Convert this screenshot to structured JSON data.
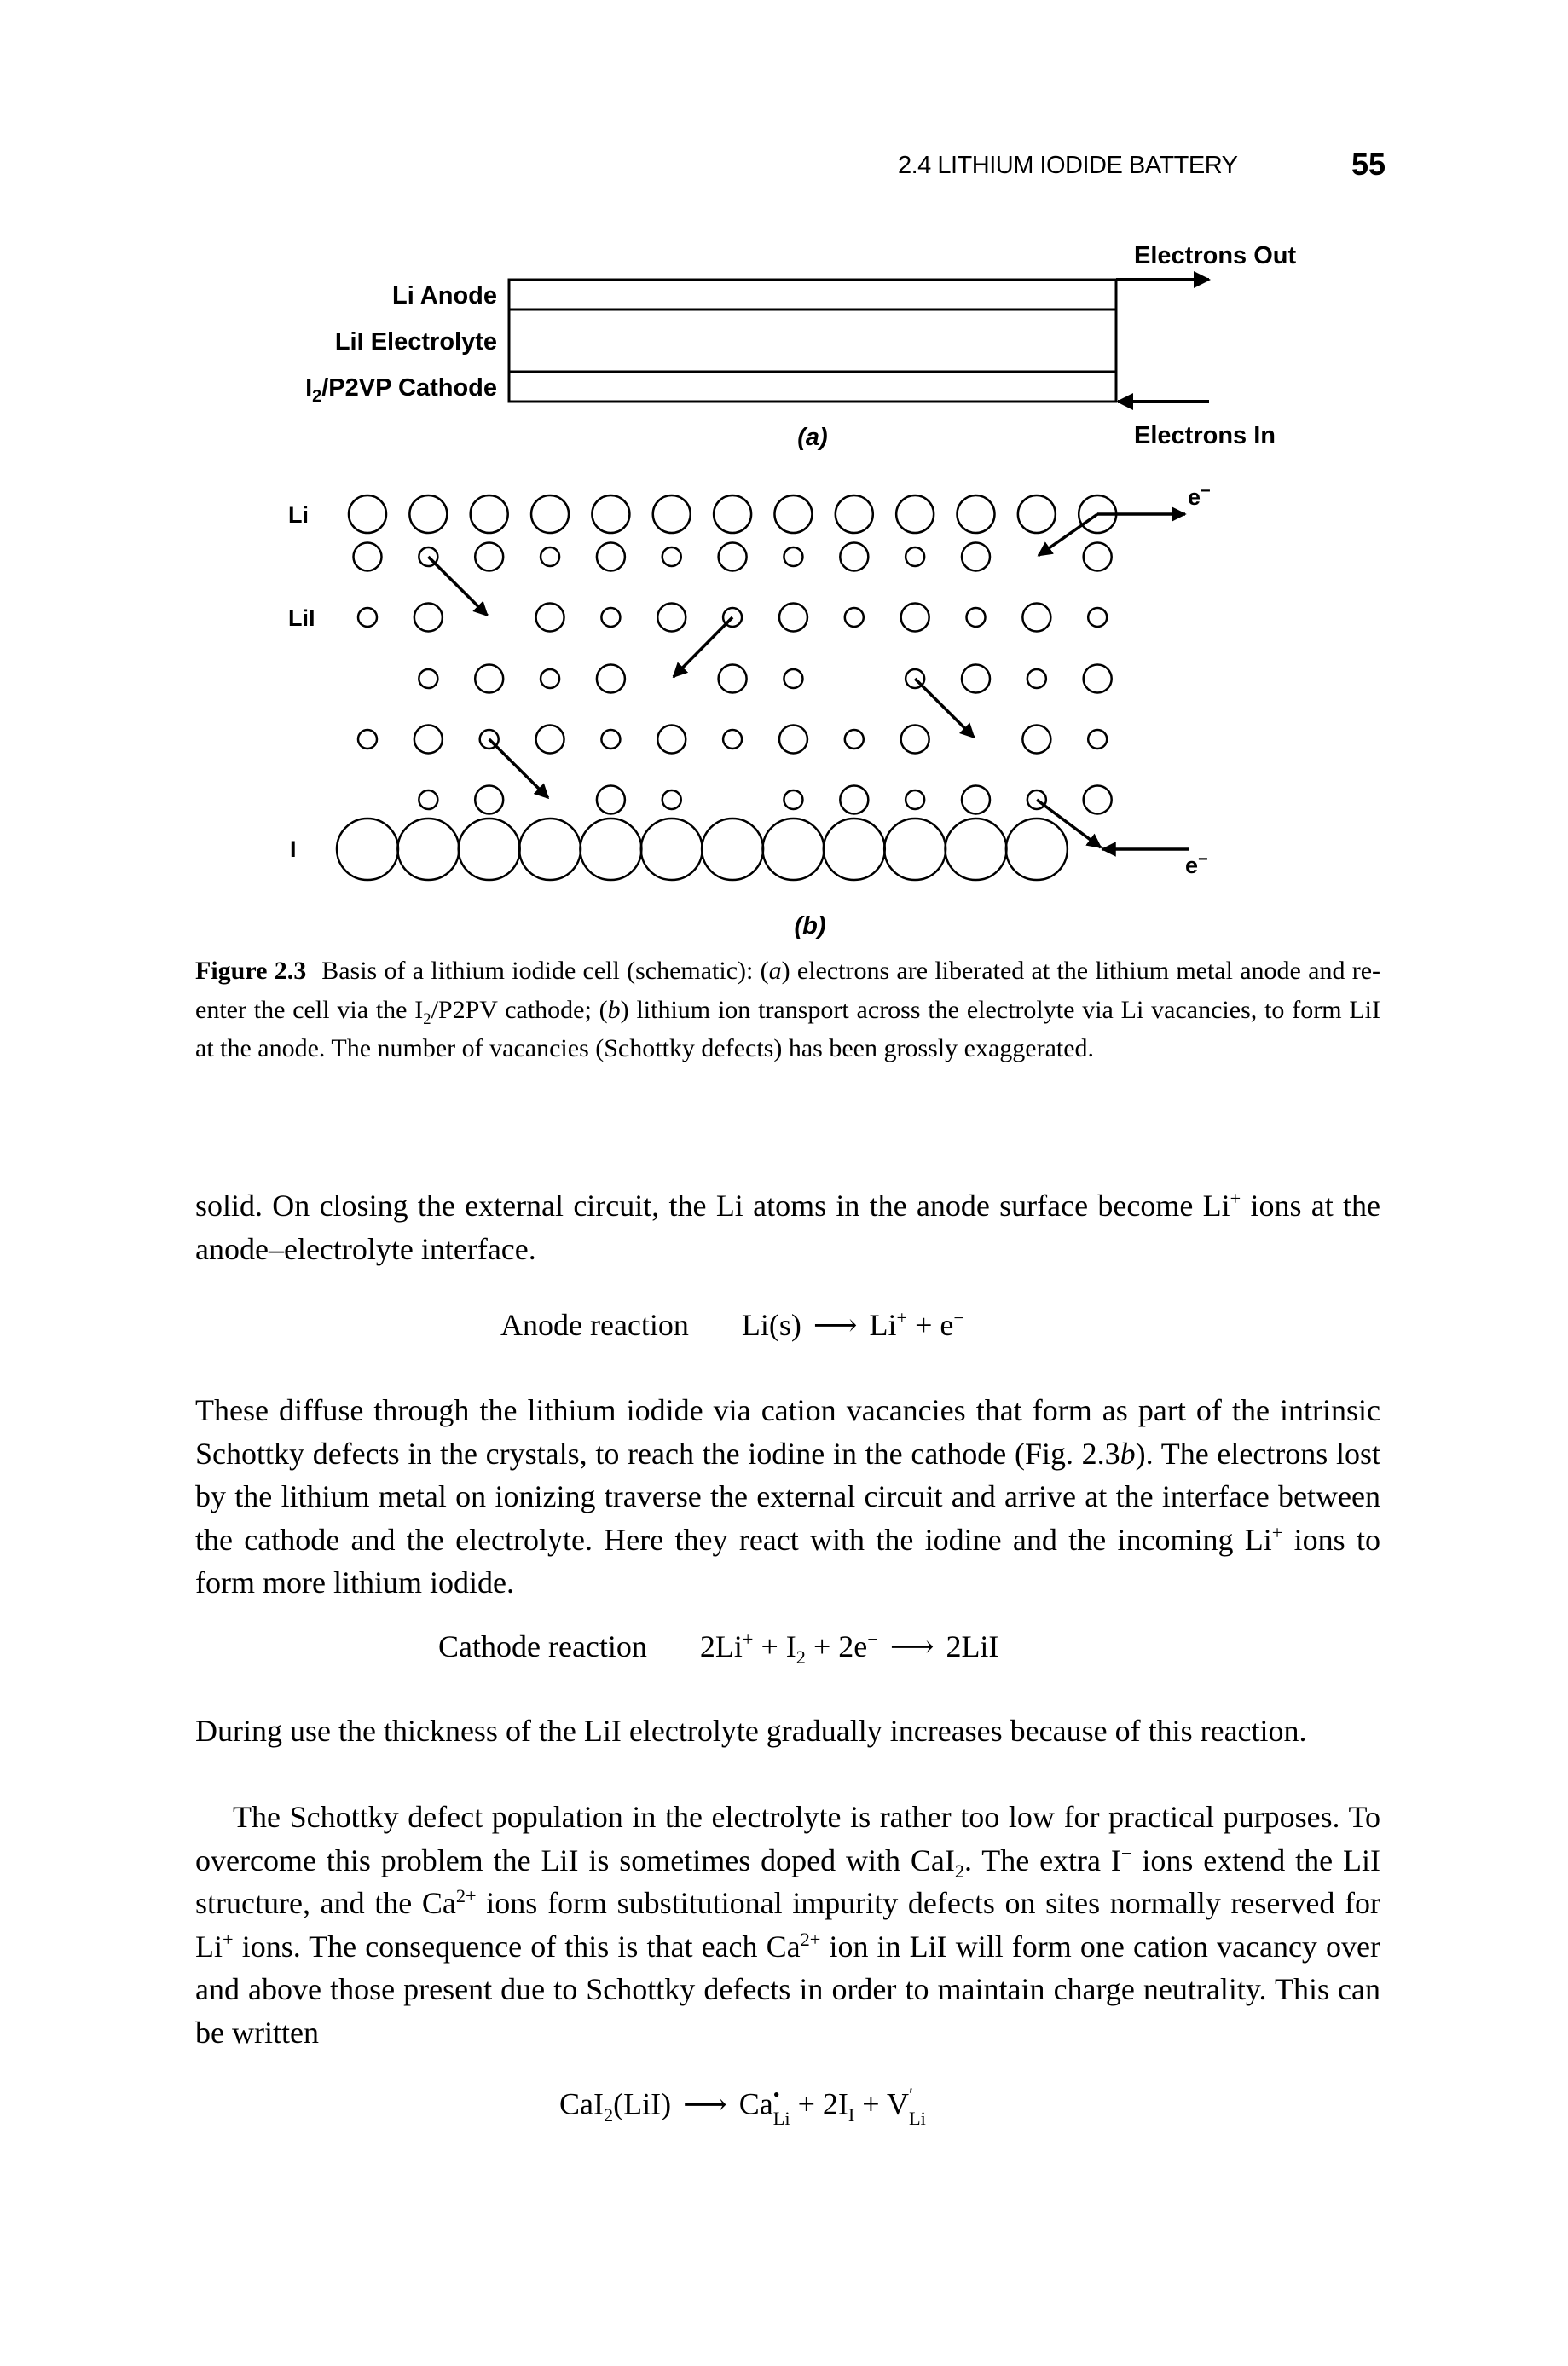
{
  "header": {
    "running_title": "2.4 LITHIUM IODIDE BATTERY",
    "page_number": "55"
  },
  "figure": {
    "panel_a": {
      "layer_labels": [
        "Li Anode",
        "LiI Electrolyte",
        "/P2VP  Cathode"
      ],
      "cathode_label_prefix": "I",
      "cathode_label_sub": "2",
      "electrons_out": "Electrons Out",
      "electrons_in": "Electrons In",
      "panel_label": "(a)"
    },
    "panel_b": {
      "row_labels": {
        "li": "Li",
        "lii": "LiI",
        "i": "I"
      },
      "electron_label": "e",
      "electron_sup": "−",
      "panel_label": "(b)",
      "rows": [
        {
          "name": "Li",
          "sites": "LLLLLLLLLLLLL",
          "kind": "li"
        },
        {
          "name": "row2",
          "sites": "BsBsBsBsBsB_B",
          "kind": "ion"
        },
        {
          "name": "LiI",
          "sites": "sB_BsBsBsBsBs",
          "kind": "ion"
        },
        {
          "name": "row4",
          "sites": "_sBsB_Bs_sBsB",
          "kind": "ion"
        },
        {
          "name": "row5",
          "sites": "sBsBsBsBsB_Bs",
          "kind": "ion"
        },
        {
          "name": "row6",
          "sites": "_sB_Bs_sBsBsB",
          "kind": "ion"
        },
        {
          "name": "I",
          "sites": "IIIIIIIIIIII",
          "kind": "iodine"
        }
      ],
      "vacancy_jumps": [
        {
          "from_row": 1,
          "from_col": 1,
          "to_row": 2,
          "to_col": 2
        },
        {
          "from_row": 2,
          "from_col": 6,
          "to_row": 3,
          "to_col": 5
        },
        {
          "from_row": 3,
          "from_col": 9,
          "to_row": 4,
          "to_col": 10
        },
        {
          "from_row": 4,
          "from_col": 2,
          "to_row": 5,
          "to_col": 3
        },
        {
          "from_row": 0,
          "from_col": 12,
          "to_row": 1,
          "to_col": 11
        }
      ]
    }
  },
  "caption": {
    "label": "Figure 2.3",
    "text_1": "Basis of a lithium iodide cell (schematic): (",
    "a": "a",
    "text_2": ") electrons are liberated at the lithium metal anode and re-enter the cell via the I",
    "sub2": "2",
    "text_3": "/P2PV cathode; (",
    "b": "b",
    "text_4": ") lithium ion transport across the electrolyte via Li vacancies, to form LiI at the anode. The number of vacancies (Schottky defects) has been grossly exaggerated."
  },
  "body": {
    "p1_a": "solid. On closing the external circuit, the Li atoms in the anode surface become Li",
    "p1_sup": "+",
    "p1_b": " ions at the anode–electrolyte interface.",
    "anode_eq": {
      "label": "Anode reaction",
      "lhs": "Li(s)",
      "arrow": "⟶",
      "rhs_li": "Li",
      "rhs_li_sup": "+",
      "plus": " + e",
      "e_sup": "−"
    },
    "p2_a": "These diffuse through the lithium iodide via cation vacancies that form as part of the intrinsic Schottky defects in the crystals, to reach the iodine in the cathode (Fig. 2.3",
    "p2_b_italic": "b",
    "p2_c": "). The electrons lost by the lithium metal on ionizing traverse the external circuit and arrive at the interface between the cathode and the electrolyte. Here they react with the iodine and the incoming Li",
    "p2_sup": "+",
    "p2_d": " ions to form more lithium iodide.",
    "cathode_eq": {
      "label": "Cathode reaction",
      "t1": "2Li",
      "t1_sup": "+",
      "t2": " + I",
      "t2_sub": "2",
      "t3": " + 2e",
      "t3_sup": "−",
      "arrow": "⟶",
      "rhs": "2LiI"
    },
    "p3": "During use the thickness of the LiI electrolyte gradually increases because of this reaction.",
    "p4_a": "The Schottky defect population in the electrolyte is rather too low for practical purposes. To overcome this problem the LiI is sometimes doped with CaI",
    "p4_sub": "2",
    "p4_b": ". The extra I",
    "p4_sup1": "−",
    "p4_c": " ions extend the LiI structure, and the Ca",
    "p4_sup2": "2+",
    "p4_d": " ions form substitutional impurity defects on sites normally reserved for Li",
    "p4_sup3": "+",
    "p4_e": " ions. The consequence of this is that each Ca",
    "p4_sup4": "2+",
    "p4_f": " ion in LiI will form one cation vacancy over and above those present due to Schottky defects in order to maintain charge neutrality. This can be written",
    "final_eq": {
      "lhs": "CaI",
      "lhs_sub": "2",
      "lhs_rest": "(LiI)",
      "arrow": "⟶",
      "ca": "Ca",
      "ca_sup": "•",
      "ca_sub": "Li",
      "plus1": " + 2I",
      "i_sub": "I",
      "plus2": " + V",
      "v_sup": "′",
      "v_sub": "Li"
    }
  }
}
